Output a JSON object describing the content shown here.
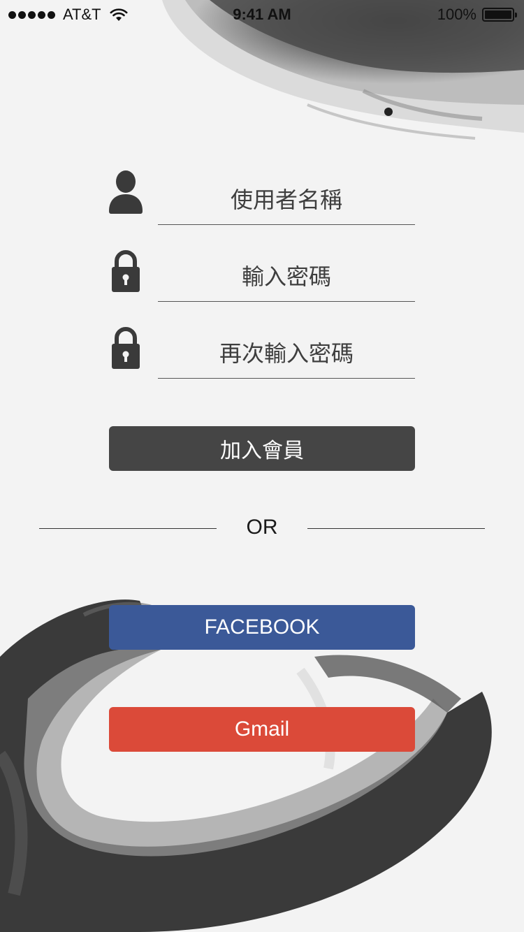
{
  "status_bar": {
    "carrier": "AT&T",
    "time": "9:41 AM",
    "battery": "100%"
  },
  "form": {
    "username_placeholder": "使用者名稱",
    "password_placeholder": "輸入密碼",
    "confirm_password_placeholder": "再次輸入密碼",
    "join_label": "加入會員"
  },
  "divider": {
    "text": "OR"
  },
  "social": {
    "facebook_label": "FACEBOOK",
    "gmail_label": "Gmail"
  },
  "colors": {
    "join_button": "#454545",
    "facebook_button": "#3b5998",
    "gmail_button": "#db4a39",
    "icon": "#3a3a3a"
  },
  "icons": {
    "user": "user-icon",
    "lock": "lock-icon",
    "wifi": "wifi-icon",
    "battery": "battery-icon"
  }
}
